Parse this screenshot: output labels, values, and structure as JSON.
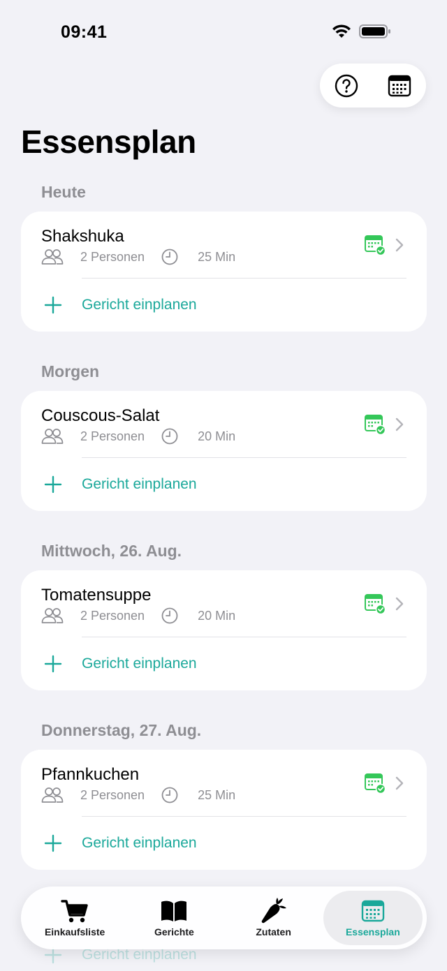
{
  "status_bar": {
    "time": "09:41"
  },
  "header": {
    "title": "Essensplan",
    "help_icon": "question-circle-icon",
    "calendar_icon": "calendar-icon"
  },
  "sections": [
    {
      "title": "Heute",
      "meal": {
        "name": "Shakshuka",
        "persons": "2 Personen",
        "duration": "25 Min"
      },
      "add_label": "Gericht einplanen"
    },
    {
      "title": "Morgen",
      "meal": {
        "name": "Couscous-Salat",
        "persons": "2 Personen",
        "duration": "20 Min"
      },
      "add_label": "Gericht einplanen"
    },
    {
      "title": "Mittwoch, 26. Aug.",
      "meal": {
        "name": "Tomatensuppe",
        "persons": "2 Personen",
        "duration": "20 Min"
      },
      "add_label": "Gericht einplanen"
    },
    {
      "title": "Donnerstag, 27. Aug.",
      "meal": {
        "name": "Pfannkuchen",
        "persons": "2 Personen",
        "duration": "25 Min"
      },
      "add_label": "Gericht einplanen"
    }
  ],
  "partially_hidden": {
    "add_label": "Gericht einplanen"
  },
  "tab_bar": {
    "tabs": [
      {
        "label": "Einkaufsliste",
        "icon": "shopping-cart-icon"
      },
      {
        "label": "Gerichte",
        "icon": "book-icon"
      },
      {
        "label": "Zutaten",
        "icon": "carrot-icon"
      },
      {
        "label": "Essensplan",
        "icon": "calendar-icon",
        "active": true
      }
    ]
  },
  "colors": {
    "accent": "#1aa89a",
    "planned_green": "#34c759",
    "background": "#f2f2f7",
    "secondary_text": "#8e8e93"
  }
}
